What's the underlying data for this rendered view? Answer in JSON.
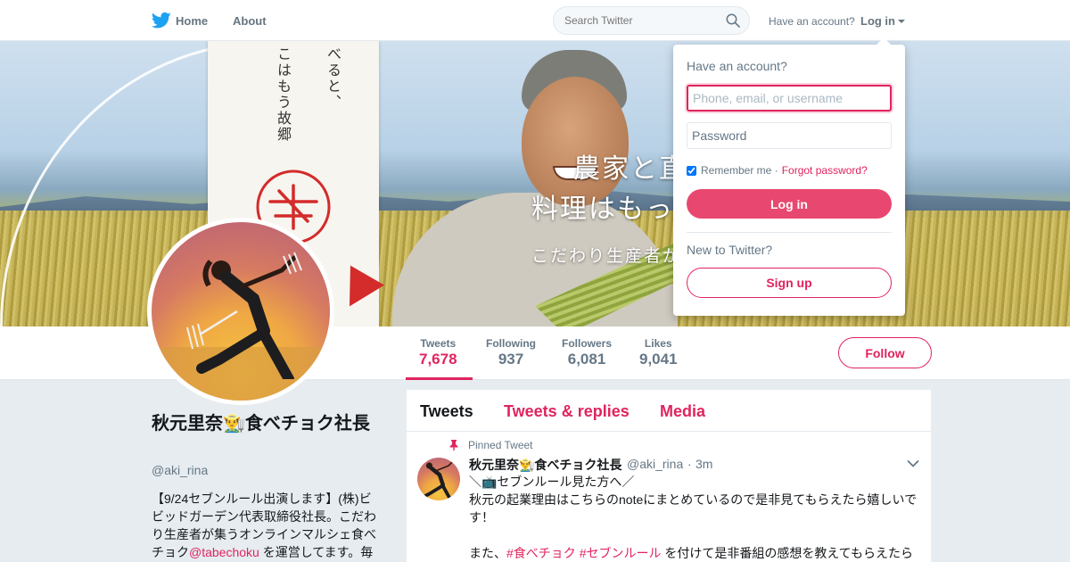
{
  "topbar": {
    "nav": {
      "home": "Home",
      "about": "About"
    },
    "search_placeholder": "Search Twitter",
    "have_account": "Have an account?",
    "login_label": "Log in"
  },
  "banner": {
    "poster_lines": [
      "べると、",
      "こはもう故郷"
    ],
    "copy_line1": "農家と直",
    "copy_line2": "料理はもっ",
    "copy_line3": "こだわり生産者が"
  },
  "profile": {
    "name": "秋元里奈👨‍🌾食べチョク社長",
    "handle": "@aki_rina",
    "bio_before": "【9/24セブンルール出演します】(株)ビビッドガーデン代表取締役社長。こだわり生産者が集うオンラインマルシェ食べチョク",
    "bio_mention": "@tabechoku",
    "bio_after": " を運営してます。毎"
  },
  "stats": [
    {
      "label": "Tweets",
      "value": "7,678"
    },
    {
      "label": "Following",
      "value": "937"
    },
    {
      "label": "Followers",
      "value": "6,081"
    },
    {
      "label": "Likes",
      "value": "9,041"
    }
  ],
  "follow_label": "Follow",
  "login_dropdown": {
    "title": "Have an account?",
    "username_placeholder": "Phone, email, or username",
    "password_placeholder": "Password",
    "remember_label": "Remember me",
    "separator": "·",
    "forgot_label": "Forgot password?",
    "login_button": "Log in",
    "new_label": "New to Twitter?",
    "signup_button": "Sign up"
  },
  "timeline": {
    "tabs": [
      "Tweets",
      "Tweets & replies",
      "Media"
    ],
    "pinned_label": "Pinned Tweet",
    "tweet": {
      "name": "秋元里奈👨‍🌾食べチョク社長",
      "handle": "@aki_rina",
      "dot": "·",
      "time": "3m",
      "line1": "＼📺セブンルール見た方へ／",
      "line2": "秋元の起業理由はこちらのnoteにまとめているので是非見てもらえたら嬉しいです！",
      "line3_before": "また、",
      "hashtag1": "#食べチョク",
      "hashtag2": "#セブンルール",
      "line3_after": " を付けて是非番組の感想を教えてもらえたら"
    }
  },
  "colors": {
    "accent": "#e0245e",
    "twitter_blue": "#1da1f2",
    "text_gray": "#657786"
  },
  "icons": [
    "twitter-bird-icon",
    "search-icon",
    "caret-down-icon",
    "pin-icon",
    "chevron-down-icon"
  ]
}
